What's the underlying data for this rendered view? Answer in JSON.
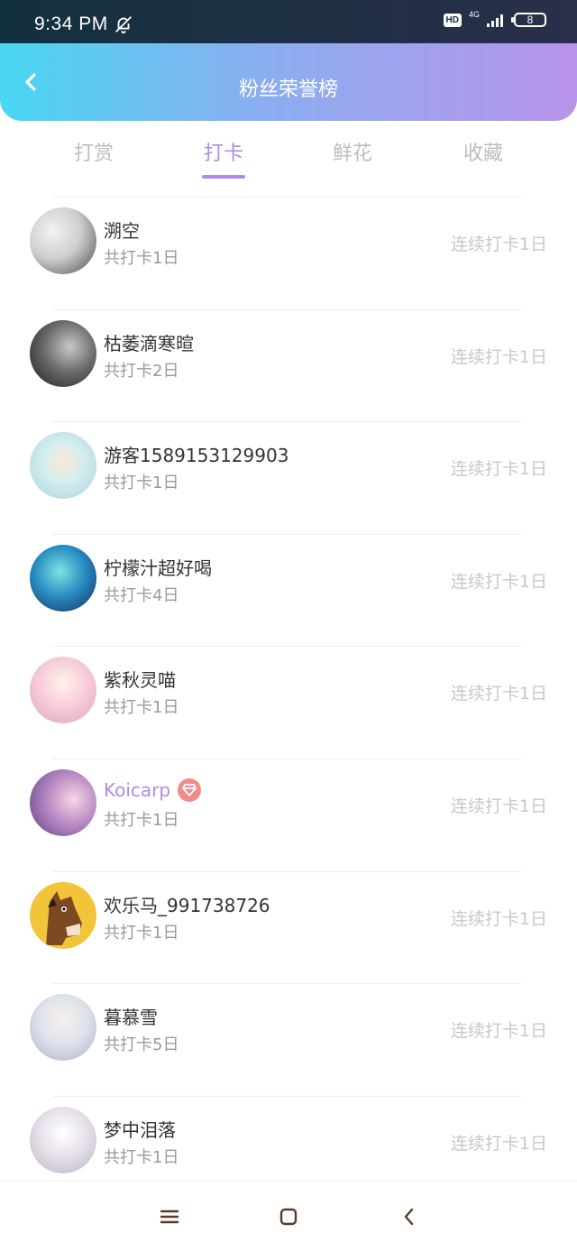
{
  "status_bar": {
    "time": "9:34 PM",
    "hd": "HD",
    "network": "4G",
    "battery": "8"
  },
  "header": {
    "title": "粉丝荣誉榜"
  },
  "tabs": [
    {
      "label": "打赏",
      "active": false
    },
    {
      "label": "打卡",
      "active": true
    },
    {
      "label": "鲜花",
      "active": false
    },
    {
      "label": "收藏",
      "active": false
    }
  ],
  "fans": [
    {
      "name": "溯空",
      "total": "共打卡1日",
      "streak": "连续打卡1日",
      "avatar_colors": [
        "#e9e9e9",
        "#3b3b3b"
      ]
    },
    {
      "name": "枯萎滴寒暄",
      "total": "共打卡2日",
      "streak": "连续打卡1日",
      "avatar_colors": [
        "#9e9e9e",
        "#1f1f1f"
      ]
    },
    {
      "name": "游客1589153129903",
      "total": "共打卡1日",
      "streak": "连续打卡1日",
      "avatar_colors": [
        "#d8f1f1",
        "#a7c9d4"
      ]
    },
    {
      "name": "柠檬汁超好喝",
      "total": "共打卡4日",
      "streak": "连续打卡1日",
      "avatar_colors": [
        "#2aa3c9",
        "#1a2b5a"
      ]
    },
    {
      "name": "紫秋灵喵",
      "total": "共打卡1日",
      "streak": "连续打卡1日",
      "avatar_colors": [
        "#f7e3ea",
        "#e9b1c4"
      ]
    },
    {
      "name": "Koicarp",
      "total": "共打卡1日",
      "streak": "连续打卡1日",
      "avatar_colors": [
        "#8e6bb8",
        "#f0c7d8"
      ],
      "vip": true
    },
    {
      "name": "欢乐马_991738726",
      "total": "共打卡1日",
      "streak": "连续打卡1日",
      "avatar_colors": [
        "#f2c43a",
        "#7b4a22"
      ]
    },
    {
      "name": "暮慕雪",
      "total": "共打卡5日",
      "streak": "连续打卡1日",
      "avatar_colors": [
        "#e3e7ef",
        "#b7c2d3"
      ]
    },
    {
      "name": "梦中泪落",
      "total": "共打卡1日",
      "streak": "连续打卡1日",
      "avatar_colors": [
        "#f1eef3",
        "#c9c2d4"
      ]
    }
  ],
  "colors": {
    "accent": "#b18be3",
    "header_start": "#49d7f2",
    "header_end": "#b894ea"
  }
}
